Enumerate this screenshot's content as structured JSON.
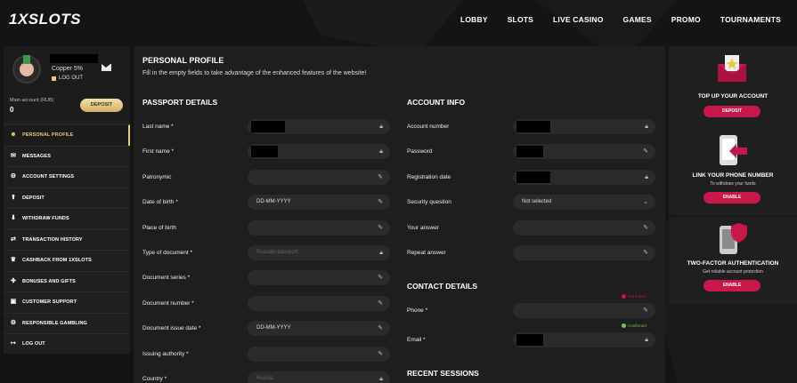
{
  "header": {
    "logo": "1XSLOTS",
    "nav": [
      "LOBBY",
      "SLOTS",
      "LIVE CASINO",
      "GAMES",
      "PROMO",
      "TOURNAMENTS"
    ]
  },
  "profile": {
    "rank": "Copper 5%",
    "logout": "LOG OUT",
    "main_account_label": "Main account (RUB)",
    "main_account_value": "0",
    "deposit_label": "DEPOSIT"
  },
  "menu": [
    {
      "label": "PERSONAL PROFILE",
      "icon": "user-gear-icon",
      "glyph": "☻"
    },
    {
      "label": "MESSAGES",
      "icon": "envelope-icon",
      "glyph": "✉"
    },
    {
      "label": "ACCOUNT SETTINGS",
      "icon": "gears-icon",
      "glyph": "⚙"
    },
    {
      "label": "DEPOSIT",
      "icon": "deposit-icon",
      "glyph": "⬆"
    },
    {
      "label": "WITHDRAW FUNDS",
      "icon": "withdraw-icon",
      "glyph": "⬇"
    },
    {
      "label": "TRANSACTION HISTORY",
      "icon": "exchange-icon",
      "glyph": "⇄"
    },
    {
      "label": "CASHBACK FROM 1XSLOTS",
      "icon": "crown-icon",
      "glyph": "♛"
    },
    {
      "label": "BONUSES AND GIFTS",
      "icon": "gift-icon",
      "glyph": "✚"
    },
    {
      "label": "CUSTOMER SUPPORT",
      "icon": "chat-icon",
      "glyph": "▣"
    },
    {
      "label": "RESPONSIBLE GAMBLING",
      "icon": "gears-icon",
      "glyph": "⚙"
    },
    {
      "label": "LOG OUT",
      "icon": "logout-icon",
      "glyph": "↦"
    }
  ],
  "main": {
    "title": "PERSONAL PROFILE",
    "subtitle": "Fill in the empty fields to take advantage of the enhanced features of the website!",
    "passport_title": "PASSPORT DETAILS",
    "account_title": "ACCOUNT INFO",
    "contact_title": "CONTACT DETAILS",
    "sessions_title": "RECENT SESSIONS",
    "passport_fields": [
      {
        "label": "Last name *",
        "value": "",
        "placeholder": "",
        "icon": "lock-icon",
        "redacted": true
      },
      {
        "label": "First name *",
        "value": "",
        "placeholder": "",
        "icon": "lock-icon",
        "redacted": true
      },
      {
        "label": "Patronymic",
        "value": "",
        "placeholder": "",
        "icon": "pencil-icon",
        "redacted": false
      },
      {
        "label": "Date of birth *",
        "value": "DD-MM-YYYY",
        "placeholder": "",
        "icon": "pencil-icon",
        "redacted": false
      },
      {
        "label": "Place of birth",
        "value": "",
        "placeholder": "",
        "icon": "pencil-icon",
        "redacted": false
      },
      {
        "label": "Type of document *",
        "value": "",
        "placeholder": "Russian passport",
        "icon": "lock-icon",
        "redacted": false
      },
      {
        "label": "Document series *",
        "value": "",
        "placeholder": "",
        "icon": "pencil-icon",
        "redacted": false
      },
      {
        "label": "Document number *",
        "value": "",
        "placeholder": "",
        "icon": "pencil-icon",
        "redacted": false
      },
      {
        "label": "Document issue date *",
        "value": "DD-MM-YYYY",
        "placeholder": "",
        "icon": "pencil-icon",
        "redacted": false
      },
      {
        "label": "Issuing authority *",
        "value": "",
        "placeholder": "",
        "icon": "pencil-icon",
        "redacted": false
      },
      {
        "label": "Country *",
        "value": "",
        "placeholder": "Russia",
        "icon": "lock-icon",
        "redacted": false
      }
    ],
    "account_fields": [
      {
        "label": "Account number",
        "value": "",
        "icon": "lock-icon",
        "redacted": true
      },
      {
        "label": "Password",
        "value": "",
        "icon": "pencil-icon",
        "redacted": true
      },
      {
        "label": "Registration date",
        "value": "",
        "icon": "lock-icon",
        "redacted": true
      },
      {
        "label": "Security question",
        "value": "Not selected",
        "icon": "chevron-down-icon",
        "redacted": false
      },
      {
        "label": "Your answer",
        "value": "",
        "icon": "pencil-icon",
        "redacted": false
      },
      {
        "label": "Repeat answer",
        "value": "",
        "icon": "pencil-icon",
        "redacted": false
      }
    ],
    "contact_fields": [
      {
        "label": "Phone *",
        "value": "",
        "icon": "pencil-icon",
        "redacted": false,
        "status": "Not linked",
        "status_color": "#c8174a"
      },
      {
        "label": "Email *",
        "value": "",
        "icon": "lock-icon",
        "redacted": true,
        "status": "Confirmed",
        "status_color": "#7cbf4e"
      }
    ]
  },
  "promos": [
    {
      "title": "TOP UP YOUR ACCOUNT",
      "sub": "",
      "button": "DEPOSIT",
      "icon": "envelope-star-icon"
    },
    {
      "title": "LINK YOUR PHONE NUMBER",
      "sub": "To withdraw your funds",
      "button": "ENABLE",
      "icon": "phone-link-icon"
    },
    {
      "title": "TWO-FACTOR AUTHENTICATION",
      "sub": "Get reliable account protection",
      "button": "ENABLE",
      "icon": "phone-shield-icon"
    }
  ],
  "colors": {
    "accent_gold": "#e8c980",
    "accent_red": "#c8174a",
    "panel": "#1e1e1e"
  }
}
